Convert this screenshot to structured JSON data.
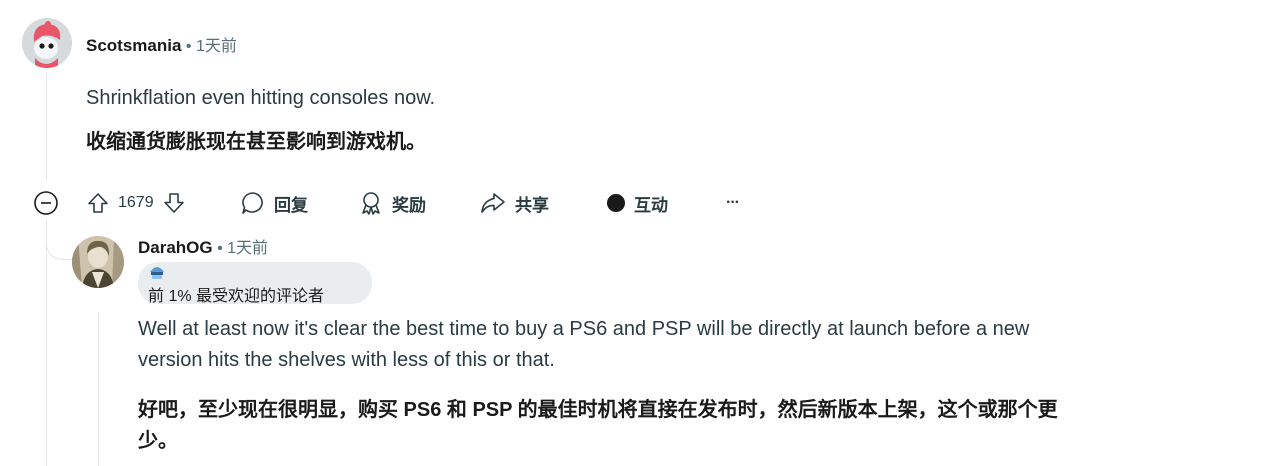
{
  "comment1": {
    "author": "Scotsmania",
    "time": "1天前",
    "text_en": "Shrinkflation even hitting consoles now.",
    "text_zh": "收缩通货膨胀现在甚至影响到游戏机。",
    "actions": {
      "vote_count": "1679",
      "reply": "回复",
      "award": "奖励",
      "share": "共享",
      "interact": "互动",
      "more": "···"
    }
  },
  "comment2": {
    "author": "DarahOG",
    "time": "1天前",
    "flair": "前 1% 最受欢迎的评论者",
    "text_en_1": "Well at least now it's clear the best time to buy a PS6 and PSP will be directly at launch before a new",
    "text_en_2": "version hits the shelves with less of this or that.",
    "text_zh_1": "好吧，至少现在很明显，购买 PS6 和 PSP 的最佳时机将直接在发布时，然后新版本上架，这个或那个更",
    "text_zh_2": "少。"
  },
  "colors": {
    "text": "#1a1a1b",
    "meta": "#576f76",
    "thread_line": "#e5e6e8",
    "flair_bg": "#eaedef",
    "avatar1_bg": "#d7dadc"
  },
  "icons": [
    "collapse-icon",
    "upvote-icon",
    "downvote-icon",
    "comment-icon",
    "award-icon",
    "share-icon",
    "interact-dot-icon",
    "more-icon",
    "flair-icon"
  ]
}
